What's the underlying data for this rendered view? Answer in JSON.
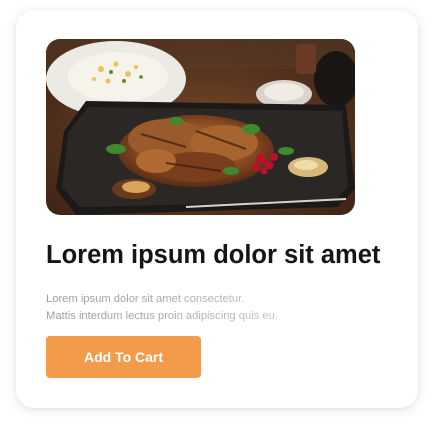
{
  "card": {
    "image_alt": "grilled meat platter with vegetables and berries",
    "title": "Lorem ipsum dolor sit amet",
    "description_line1": "Lorem ipsum dolor sit amet consectetur.",
    "description_line2": "Mattis interdum lectus proin adipiscing quis eu.",
    "button_label": "Add To Cart"
  },
  "colors": {
    "button_bg": "#f29b4a",
    "title": "#151515",
    "description": "#a8a8a8"
  }
}
